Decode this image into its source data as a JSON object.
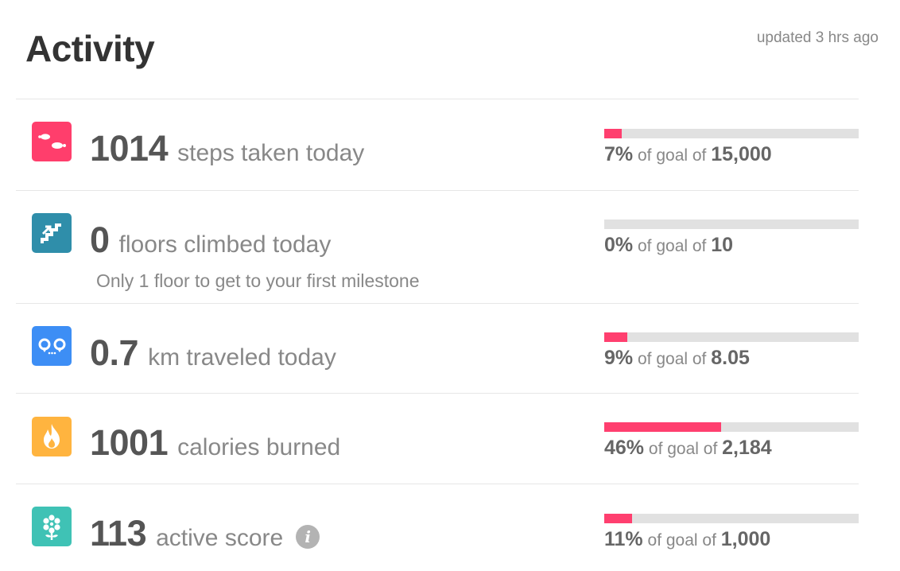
{
  "header": {
    "title": "Activity",
    "updated": "updated 3 hrs ago"
  },
  "rows": [
    {
      "icon": "footsteps-icon",
      "icon_color": "#ff3e6c",
      "value": "1014",
      "unit": "steps taken today",
      "subtext": "",
      "progress": 7,
      "percent_label": "7%",
      "goal_text": "of goal of",
      "goal_value": "15,000"
    },
    {
      "icon": "stairs-icon",
      "icon_color": "#2f8eaa",
      "value": "0",
      "unit": "floors climbed today",
      "subtext": "Only 1 floor to get to your first milestone",
      "progress": 0,
      "percent_label": "0%",
      "goal_text": "of goal of",
      "goal_value": "10"
    },
    {
      "icon": "distance-icon",
      "icon_color": "#3d8ef5",
      "value": "0.7",
      "unit": "km traveled today",
      "subtext": "",
      "progress": 9,
      "percent_label": "9%",
      "goal_text": "of goal of",
      "goal_value": "8.05"
    },
    {
      "icon": "flame-icon",
      "icon_color": "#ffb43f",
      "value": "1001",
      "unit": "calories burned",
      "subtext": "",
      "progress": 46,
      "percent_label": "46%",
      "goal_text": "of goal of",
      "goal_value": "2,184"
    },
    {
      "icon": "flower-icon",
      "icon_color": "#3fc2b5",
      "value": "113",
      "unit": "active score",
      "info_icon": "info-icon",
      "info_glyph": "i",
      "subtext": "",
      "progress": 11,
      "percent_label": "11%",
      "goal_text": "of goal of",
      "goal_value": "1,000"
    }
  ],
  "colors": {
    "bar_fill": "#ff3f6f",
    "bar_track": "#e1e1e1"
  }
}
